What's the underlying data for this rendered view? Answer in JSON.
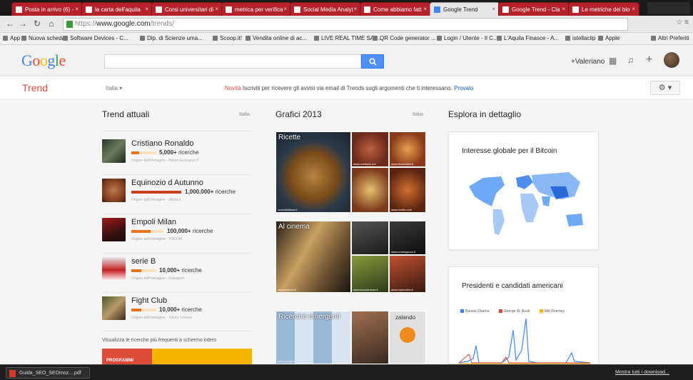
{
  "browser": {
    "tabs": [
      {
        "label": "Posta in arrivo (6) -",
        "active": false
      },
      {
        "label": "la carta dell'aquila",
        "active": false
      },
      {
        "label": "Corsi universitari di",
        "active": false
      },
      {
        "label": "metrica per verifica",
        "active": false
      },
      {
        "label": "Social Media Analyt",
        "active": false
      },
      {
        "label": "Come abbiamo fatt",
        "active": false
      },
      {
        "label": "Google Trend",
        "active": true
      },
      {
        "label": "Google Trend - Cla",
        "active": false
      },
      {
        "label": "Le metriche dei blo",
        "active": false
      }
    ],
    "address": {
      "protocol": "https://",
      "host": "www.google.com",
      "path": "/trends/"
    },
    "bookmarks": [
      "App",
      "Nuova scheda",
      "Software Devices - C...",
      "Dip. di Scienze uma...",
      "Scoop.it!",
      "Vendita online di ac...",
      "LIVE REAL TIME SAT...",
      "QR Code generator ...",
      "Login / Utente - Il C...",
      "L'Aquila Finasce - A...",
      "istellaclip",
      "Apple",
      "Altri Preferiti"
    ]
  },
  "header": {
    "logo": "Google",
    "logo_colors": [
      "#4285f4",
      "#ea4335",
      "#fbbc05",
      "#4285f4",
      "#34a853",
      "#ea4335"
    ],
    "search_button_icon": "search-icon",
    "user": "+Valeriano"
  },
  "subbar": {
    "title": "Trend",
    "country": "Italia",
    "notice_new": "Novità",
    "notice_text": "Iscriviti per ricevere gli avvisi via email di Trends sugli argomenti che ti interessano.",
    "notice_link": "Provalo"
  },
  "columns": {
    "trending": {
      "title": "Trend attuali",
      "country": "Italia"
    },
    "charts": {
      "title": "Grafici 2013",
      "country": "Italia"
    },
    "explore": {
      "title": "Esplora in dettaglio"
    }
  },
  "trends": [
    {
      "name": "Cristiano Ronaldo",
      "count": "5,000+",
      "unit": "ricerche",
      "source": "Origine dell'immagine - Yahoo Eurosport IT",
      "level": 0.3
    },
    {
      "name": "Equinozio d Autunno",
      "count": "1,000,000+",
      "unit": "ricerche",
      "source": "Origine dell'immagine - Wired.it",
      "level": 1.0
    },
    {
      "name": "Empoli Milan",
      "count": "100,000+",
      "unit": "ricerche",
      "source": "Origine dell'immagine - TGCOM",
      "level": 0.6
    },
    {
      "name": "serie B",
      "count": "10,000+",
      "unit": "ricerche",
      "source": "Origine dell'immagine - Datasport",
      "level": 0.4
    },
    {
      "name": "Fight Club",
      "count": "10,000+",
      "unit": "ricerche",
      "source": "Origine dell'immagine - Yahoo Cinema",
      "level": 0.4
    }
  ],
  "fullscreen_link": "Visualizza le ricerche più frequenti a schermo intero",
  "promo_text": "PROGRAMMI",
  "tiles": [
    {
      "label": "Ricette",
      "captions": [
        "cucinaitaliana.it",
        "www.ricettario.net",
        "www.ilcucchiaio.it",
        "www.ricette.com"
      ]
    },
    {
      "label": "Al cinema",
      "captions": [
        "www.cinema.it",
        "www.comingsoon.it",
        "www.trovacinema.it",
        "www.mymovies.it"
      ]
    },
    {
      "label": "Ricerche emergenti",
      "captions": [
        "www.zalando.it",
        "zalando",
        "www.google.it"
      ]
    }
  ],
  "cards": [
    {
      "title": "Interesse globale per il Bitcoin"
    },
    {
      "title": "Presidenti e candidati americani"
    }
  ],
  "chart_legend": [
    {
      "name": "Barack Obama",
      "color": "#4285f4"
    },
    {
      "name": "George W. Bush",
      "color": "#db4437"
    },
    {
      "name": "Mitt Romney",
      "color": "#f4b400"
    }
  ],
  "downloads": {
    "file": "Guida_SEO_SEOmoz....pdf",
    "show_all": "Mostra tutti i download..."
  }
}
